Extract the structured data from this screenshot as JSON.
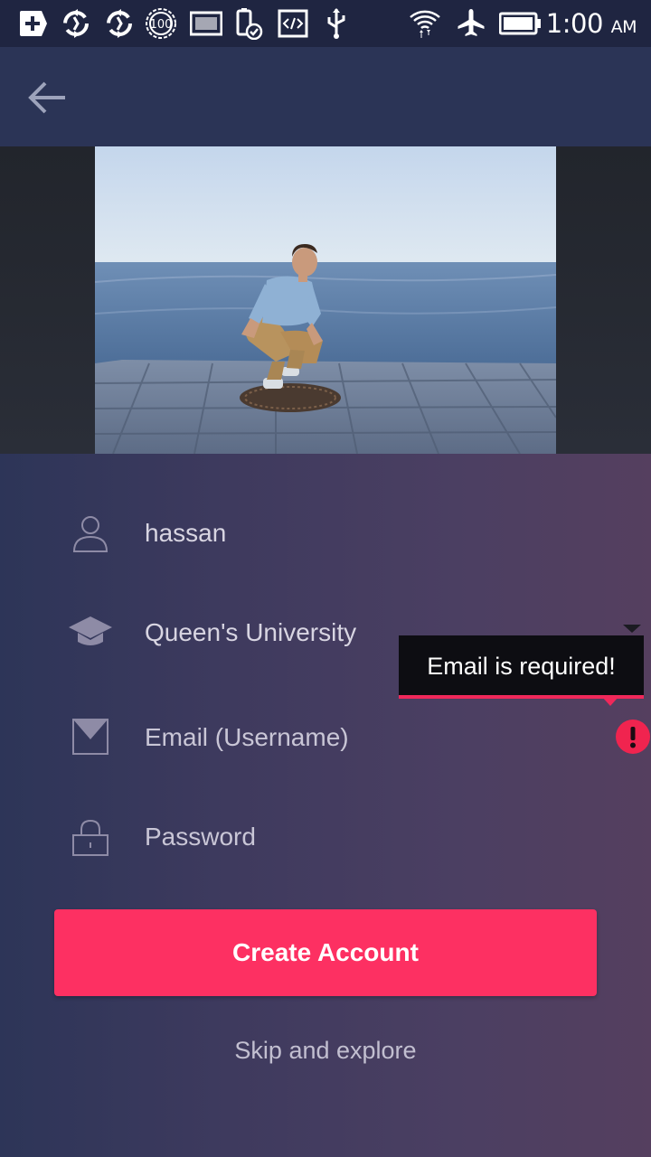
{
  "status_bar": {
    "time": "1:00",
    "ampm": "AM",
    "icons": [
      "add-box-icon",
      "sync-icon",
      "sync-icon",
      "battery-100-icon",
      "screenshot-icon",
      "battery-saver-icon",
      "code-icon",
      "usb-icon",
      "wifi-icon",
      "airplane-mode-icon",
      "battery-icon"
    ]
  },
  "app_bar": {
    "back_icon": "arrow-back-icon"
  },
  "form": {
    "name_value": "hassan",
    "university_value": "Queen's University",
    "email_placeholder": "Email (Username)",
    "password_placeholder": "Password"
  },
  "error": {
    "message": "Email is required!"
  },
  "actions": {
    "create_label": "Create Account",
    "skip_label": "Skip and explore"
  },
  "colors": {
    "accent": "#fd3062",
    "error": "#f0244f",
    "app_bar": "#2b3456",
    "status_bar": "#1f2541"
  }
}
